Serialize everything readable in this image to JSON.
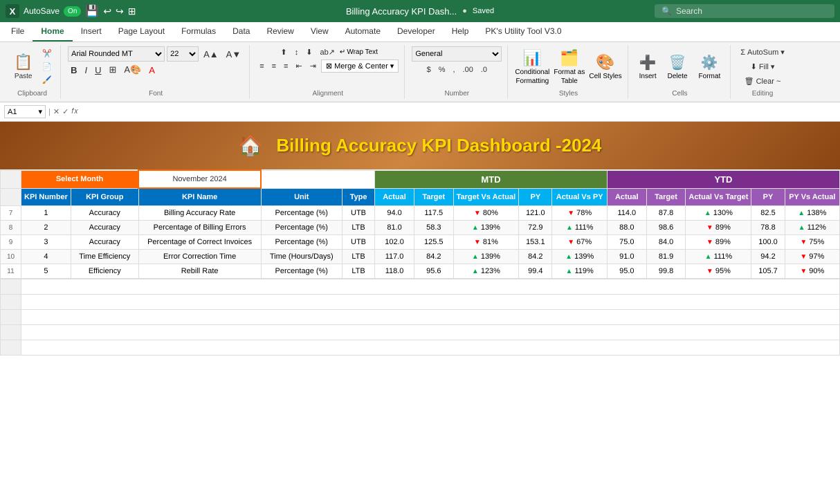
{
  "titleBar": {
    "appName": "Excel",
    "autosave": "AutoSave",
    "autosaveOn": "On",
    "docTitle": "Billing Accuracy KPI Dash...",
    "savedLabel": "Saved",
    "searchPlaceholder": "Search"
  },
  "ribbonTabs": [
    {
      "label": "File",
      "active": false
    },
    {
      "label": "Home",
      "active": true
    },
    {
      "label": "Insert",
      "active": false
    },
    {
      "label": "Page Layout",
      "active": false
    },
    {
      "label": "Formulas",
      "active": false
    },
    {
      "label": "Data",
      "active": false
    },
    {
      "label": "Review",
      "active": false
    },
    {
      "label": "View",
      "active": false
    },
    {
      "label": "Automate",
      "active": false
    },
    {
      "label": "Developer",
      "active": false
    },
    {
      "label": "Help",
      "active": false
    },
    {
      "label": "PK's Utility Tool V3.0",
      "active": false
    }
  ],
  "ribbon": {
    "clipboard": {
      "label": "Clipboard",
      "paste": "Paste",
      "cut": "Cut",
      "copy": "Copy",
      "formatPainter": "Format Painter"
    },
    "font": {
      "label": "Font",
      "fontName": "Arial Rounded MT",
      "fontSize": "22",
      "bold": "B",
      "italic": "I",
      "underline": "U",
      "borders": "Borders",
      "fillColor": "Fill Color",
      "fontColor": "Font Color"
    },
    "alignment": {
      "label": "Alignment",
      "wrapText": "Wrap Text",
      "mergeCenterLabel": "Merge & Center"
    },
    "number": {
      "label": "Number",
      "format": "General"
    },
    "styles": {
      "label": "Styles",
      "conditionalFormatting": "Conditional Formatting",
      "formatAsTable": "Format as Table",
      "cellStyles": "Cell Styles"
    },
    "cells": {
      "label": "Cells",
      "insert": "Insert",
      "delete": "Delete",
      "format": "Format"
    },
    "editing": {
      "label": "Editing",
      "autoSum": "AutoSum",
      "fill": "Fill",
      "clear": "Clear ~"
    }
  },
  "formulaBar": {
    "cellRef": "A1",
    "formula": ""
  },
  "dashboard": {
    "title": "Billing Accuracy KPI Dashboard  -2024",
    "selectMonthLabel": "Select Month",
    "selectedMonth": "November 2024",
    "mtdLabel": "MTD",
    "ytdLabel": "YTD",
    "columns": {
      "kpiNumber": "KPI Number",
      "kpiGroup": "KPI Group",
      "kpiName": "KPI Name",
      "unit": "Unit",
      "type": "Type",
      "mtd": {
        "actual": "Actual",
        "target": "Target",
        "targetVsActual": "Target Vs Actual",
        "py": "PY",
        "actualVsPY": "Actual Vs PY"
      },
      "ytd": {
        "actual": "Actual",
        "target": "Target",
        "actualVsTarget": "Actual Vs Target",
        "py": "PY",
        "pyVsActual": "PY Vs Actual"
      }
    },
    "rows": [
      {
        "num": 1,
        "group": "Accuracy",
        "name": "Billing Accuracy Rate",
        "unit": "Percentage (%)",
        "type": "UTB",
        "mtdActual": "94.0",
        "mtdTarget": "117.5",
        "mtdTVA": "80%",
        "mtdTVADir": "down",
        "mtdPY": "121.0",
        "mtdAVP": "78%",
        "mtdAVPDir": "down",
        "ytdActual": "114.0",
        "ytdTarget": "87.8",
        "ytdAVT": "130%",
        "ytdAVTDir": "up",
        "ytdPY": "82.5",
        "ytdPVA": "138%",
        "ytdPVADir": "up"
      },
      {
        "num": 2,
        "group": "Accuracy",
        "name": "Percentage of Billing Errors",
        "unit": "Percentage (%)",
        "type": "LTB",
        "mtdActual": "81.0",
        "mtdTarget": "58.3",
        "mtdTVA": "139%",
        "mtdTVADir": "up",
        "mtdPY": "72.9",
        "mtdAVP": "111%",
        "mtdAVPDir": "up",
        "ytdActual": "88.0",
        "ytdTarget": "98.6",
        "ytdAVT": "89%",
        "ytdAVTDir": "down",
        "ytdPY": "78.8",
        "ytdPVA": "112%",
        "ytdPVADir": "up"
      },
      {
        "num": 3,
        "group": "Accuracy",
        "name": "Percentage of Correct Invoices",
        "unit": "Percentage (%)",
        "type": "UTB",
        "mtdActual": "102.0",
        "mtdTarget": "125.5",
        "mtdTVA": "81%",
        "mtdTVADir": "down",
        "mtdPY": "153.1",
        "mtdAVP": "67%",
        "mtdAVPDir": "down",
        "ytdActual": "75.0",
        "ytdTarget": "84.0",
        "ytdAVT": "89%",
        "ytdAVTDir": "down",
        "ytdPY": "100.0",
        "ytdPVA": "75%",
        "ytdPVADir": "down"
      },
      {
        "num": 4,
        "group": "Time Efficiency",
        "name": "Error Correction Time",
        "unit": "Time (Hours/Days)",
        "type": "LTB",
        "mtdActual": "117.0",
        "mtdTarget": "84.2",
        "mtdTVA": "139%",
        "mtdTVADir": "up",
        "mtdPY": "84.2",
        "mtdAVP": "139%",
        "mtdAVPDir": "up",
        "ytdActual": "91.0",
        "ytdTarget": "81.9",
        "ytdAVT": "111%",
        "ytdAVTDir": "up",
        "ytdPY": "94.2",
        "ytdPVA": "97%",
        "ytdPVADir": "down"
      },
      {
        "num": 5,
        "group": "Efficiency",
        "name": "Rebill Rate",
        "unit": "Percentage (%)",
        "type": "LTB",
        "mtdActual": "118.0",
        "mtdTarget": "95.6",
        "mtdTVA": "123%",
        "mtdTVADir": "up",
        "mtdPY": "99.4",
        "mtdAVP": "119%",
        "mtdAVPDir": "up",
        "ytdActual": "95.0",
        "ytdTarget": "99.8",
        "ytdAVT": "95%",
        "ytdAVTDir": "down",
        "ytdPY": "105.7",
        "ytdPVA": "90%",
        "ytdPVADir": "down"
      }
    ]
  }
}
